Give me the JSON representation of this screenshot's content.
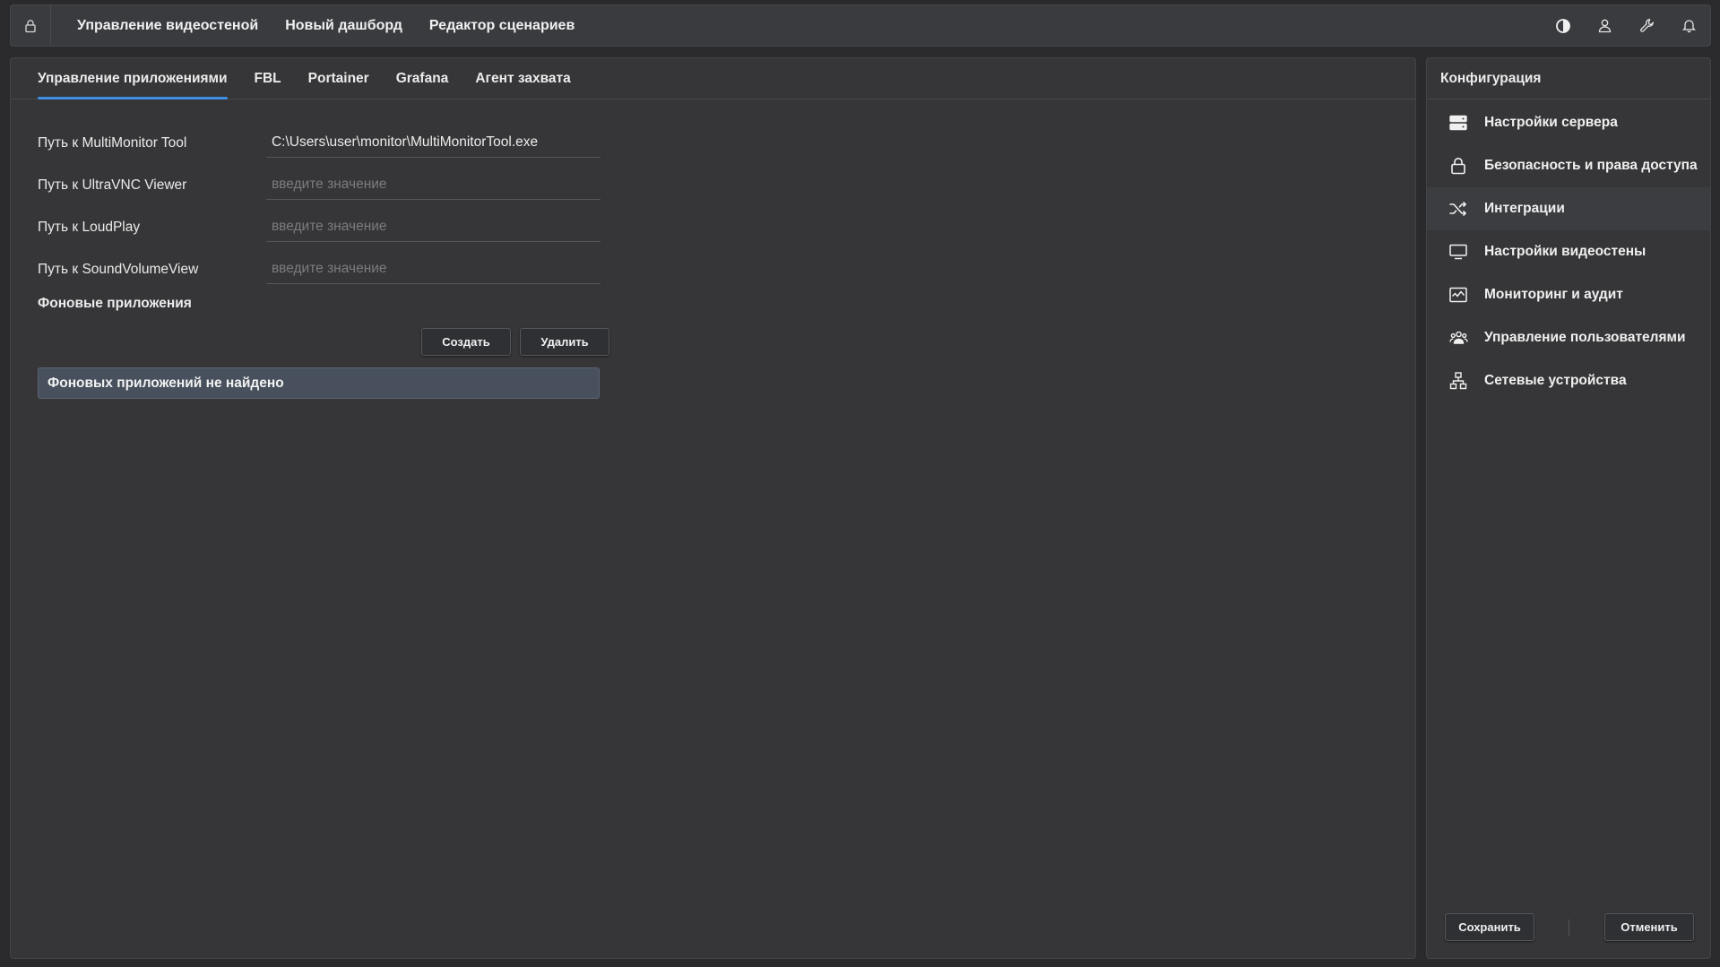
{
  "topbar": {
    "lock_icon": "lock-icon",
    "nav": [
      {
        "label": "Управление видеостеной"
      },
      {
        "label": "Новый дашборд"
      },
      {
        "label": "Редактор сценариев"
      }
    ],
    "actions": [
      "contrast-icon",
      "user-icon",
      "wrench-icon",
      "bell-icon"
    ]
  },
  "main": {
    "tabs": [
      {
        "label": "Управление приложениями",
        "active": true
      },
      {
        "label": "FBL"
      },
      {
        "label": "Portainer"
      },
      {
        "label": "Grafana"
      },
      {
        "label": "Агент захвата"
      }
    ],
    "fields": [
      {
        "label": "Путь к MultiMonitor Tool",
        "value": "C:\\Users\\user\\monitor\\MultiMonitorTool.exe",
        "placeholder": "введите значение"
      },
      {
        "label": "Путь к UltraVNC Viewer",
        "value": "",
        "placeholder": "введите значение"
      },
      {
        "label": "Путь к LoudPlay",
        "value": "",
        "placeholder": "введите значение"
      },
      {
        "label": "Путь к SoundVolumeView",
        "value": "",
        "placeholder": "введите значение"
      }
    ],
    "background_apps_title": "Фоновые приложения",
    "create_label": "Создать",
    "delete_label": "Удалить",
    "empty_message": "Фоновых приложений не найдено"
  },
  "sidebar": {
    "title": "Конфигурация",
    "items": [
      {
        "label": "Настройки сервера",
        "icon": "server-icon"
      },
      {
        "label": "Безопасность и права доступа",
        "icon": "lock-icon"
      },
      {
        "label": "Интеграции",
        "icon": "shuffle-icon",
        "active": true
      },
      {
        "label": "Настройки видеостены",
        "icon": "monitor-icon"
      },
      {
        "label": "Мониторинг и аудит",
        "icon": "activity-icon"
      },
      {
        "label": "Управление пользователями",
        "icon": "users-icon"
      },
      {
        "label": "Сетевые устройства",
        "icon": "network-icon"
      }
    ],
    "save_label": "Сохранить",
    "cancel_label": "Отменить"
  },
  "colors": {
    "background": "#2a2a2c",
    "panel": "#363638",
    "accent": "#3d8fe0",
    "empty_box": "#47505c"
  }
}
